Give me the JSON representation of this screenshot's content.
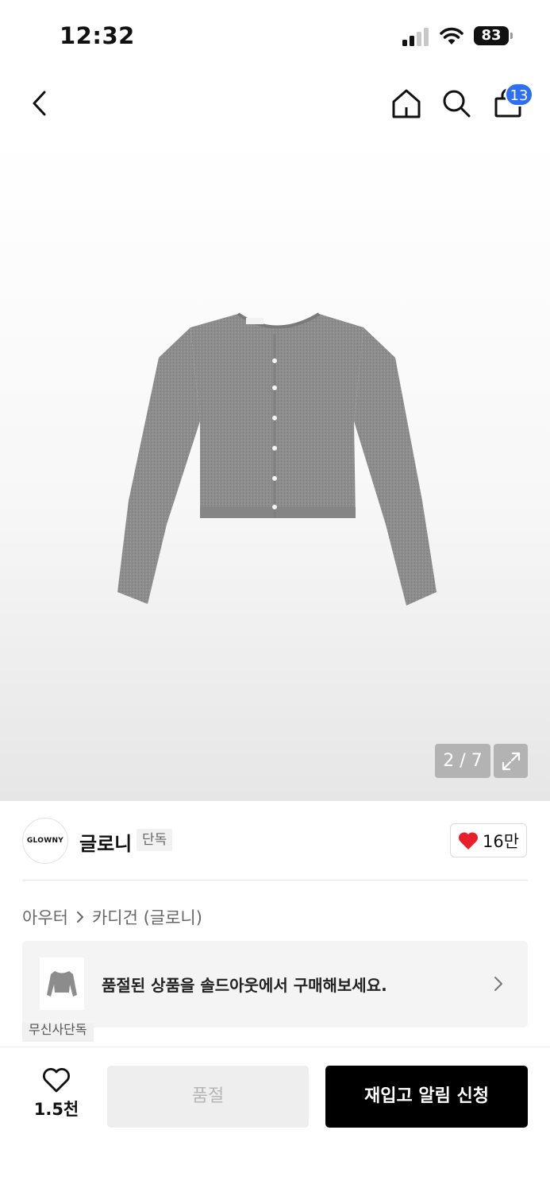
{
  "status_bar": {
    "time": "12:32",
    "battery": "83"
  },
  "nav": {
    "cart_count": "13"
  },
  "product": {
    "image_page": "2 / 7"
  },
  "brand": {
    "logo_text": "GLOWNY",
    "name": "글로니",
    "tag": "단독",
    "likes": "16만"
  },
  "breadcrumb": {
    "category": "아우터",
    "subcategory": "카디건 (글로니)"
  },
  "soldout_banner": {
    "text": "품절된 상품을 솔드아웃에서 구매해보세요.",
    "tag": "무신사단독"
  },
  "action_bar": {
    "wish_count": "1.5천",
    "soldout_label": "품절",
    "restock_label": "재입고 알림 신청"
  },
  "colors": {
    "badge": "#2d6ff0",
    "heart": "#e8202b",
    "primary_button": "#000000",
    "disabled_button": "#eeeeee"
  }
}
